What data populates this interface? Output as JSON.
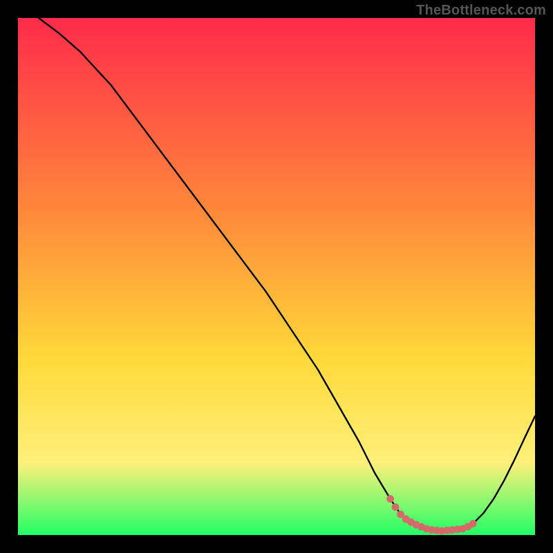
{
  "attribution": "TheBottleneck.com",
  "colors": {
    "page_bg": "#000000",
    "grad_top": "#ff2b4a",
    "grad_mid1": "#ff8a3a",
    "grad_mid2": "#ffd93a",
    "grad_mid3": "#fff07a",
    "grad_bot": "#22ff66",
    "curve": "#000000",
    "marker": "#d46a6a"
  },
  "chart_data": {
    "type": "line",
    "title": "",
    "xlabel": "",
    "ylabel": "",
    "xlim": [
      0,
      100
    ],
    "ylim": [
      0,
      100
    ],
    "grid": false,
    "series": [
      {
        "name": "curve",
        "x": [
          4,
          8,
          12,
          18,
          24,
          30,
          36,
          42,
          48,
          54,
          58,
          62,
          66,
          69,
          72,
          74,
          76,
          78,
          80,
          82,
          84,
          86,
          88,
          90,
          92,
          94,
          96,
          98,
          100
        ],
        "y": [
          100,
          97,
          93.5,
          87,
          79,
          71,
          63,
          55,
          47,
          38,
          32,
          25,
          18,
          12,
          7,
          4,
          2.5,
          1.6,
          1.0,
          0.8,
          0.8,
          1.2,
          2.2,
          4.2,
          7.0,
          10.5,
          14.5,
          18.8,
          23
        ]
      }
    ],
    "markers": {
      "name": "flat-region",
      "x": [
        72,
        73,
        74,
        75,
        76,
        77,
        78,
        79,
        80,
        81,
        82,
        83,
        84,
        85,
        86,
        87,
        88
      ],
      "y": [
        7.0,
        5.4,
        4.0,
        3.1,
        2.5,
        2.0,
        1.6,
        1.2,
        1.0,
        0.9,
        0.8,
        0.9,
        1.0,
        1.1,
        1.2,
        1.6,
        2.2
      ]
    },
    "legend": null
  }
}
